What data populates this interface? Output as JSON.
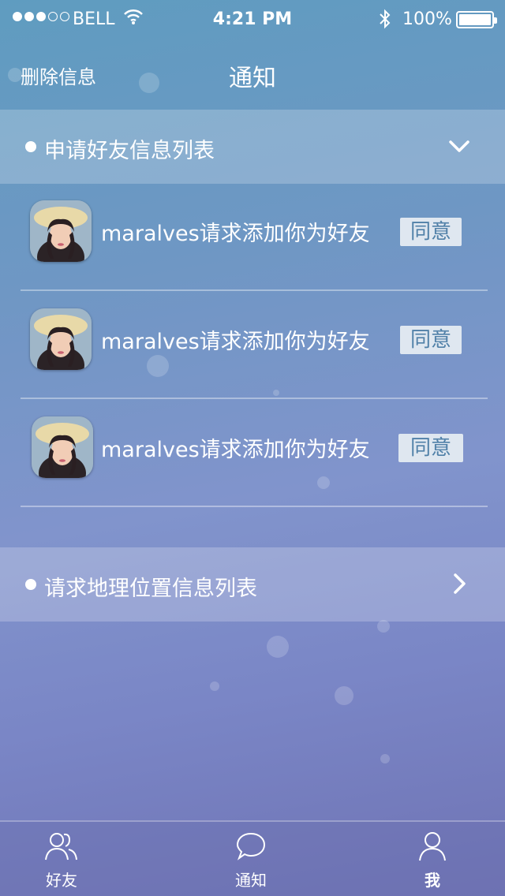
{
  "status_bar": {
    "carrier": "BELL",
    "time": "4:21 PM",
    "battery": "100%"
  },
  "nav": {
    "left_action": "删除信息",
    "title": "通知"
  },
  "sections": {
    "friend_requests": {
      "title": "申请好友信息列表",
      "items": [
        {
          "username": "maralves",
          "message": "maralves请求添加你为好友",
          "action": "同意"
        },
        {
          "username": "maralves",
          "message": "maralves请求添加你为好友",
          "action": "同意"
        },
        {
          "username": "maralves",
          "message": "maralves请求添加你为好友",
          "action": "同意"
        }
      ]
    },
    "location_requests": {
      "title": "请求地理位置信息列表"
    }
  },
  "tab_bar": {
    "items": [
      {
        "label": "好友",
        "icon": "friends-icon"
      },
      {
        "label": "通知",
        "icon": "chat-bubble-icon"
      },
      {
        "label": "我",
        "icon": "person-icon"
      }
    ]
  },
  "colors": {
    "agree_button_bg": "#dfe7f0",
    "agree_button_text": "#5080a8",
    "background_top": "#5f9cc0",
    "background_bottom": "#6f73b4"
  }
}
